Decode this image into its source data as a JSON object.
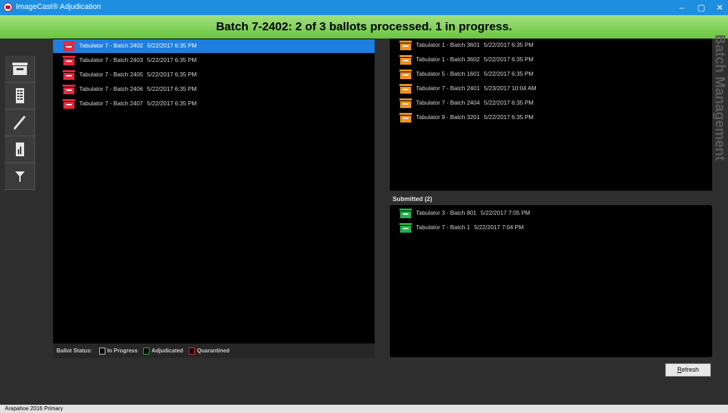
{
  "window": {
    "title": "ImageCast® Adjudication",
    "minimize": "–",
    "maximize": "▢",
    "close": "✕"
  },
  "banner": {
    "text": "Batch 7-2402: 2 of 3 ballots processed. 1 in progress."
  },
  "toolbar": {
    "items": [
      "batch-box",
      "ballot-list",
      "pencil",
      "report",
      "filter"
    ]
  },
  "left_list": {
    "items": [
      {
        "name": "Tabulator 7 - Batch 2402",
        "date": "5/22/2017 6:35 PM",
        "status": "quarantined",
        "selected": true
      },
      {
        "name": "Tabulator 7 - Batch 2403",
        "date": "5/22/2017 6:35 PM",
        "status": "quarantined",
        "selected": false
      },
      {
        "name": "Tabulator 7 - Batch 2405",
        "date": "5/22/2017 6:35 PM",
        "status": "quarantined",
        "selected": false
      },
      {
        "name": "Tabulator 7 - Batch 2406",
        "date": "5/22/2017 6:35 PM",
        "status": "quarantined",
        "selected": false
      },
      {
        "name": "Tabulator 7 - Batch 2407",
        "date": "5/22/2017 6:35 PM",
        "status": "quarantined",
        "selected": false
      }
    ]
  },
  "ballot_status": {
    "label": "Ballot Status:",
    "in_progress": "In Progress",
    "adjudicated": "Adjudicated",
    "quarantined": "Quarantined"
  },
  "right_top_list": {
    "items": [
      {
        "name": "Tabulator 1 - Batch 3601",
        "date": "5/22/2017 6:35 PM"
      },
      {
        "name": "Tabulator 1 - Batch 3602",
        "date": "5/22/2017 6:35 PM"
      },
      {
        "name": "Tabulator 5 - Batch 1601",
        "date": "5/22/2017 6:35 PM"
      },
      {
        "name": "Tabulator 7 - Batch 2401",
        "date": "5/23/2017 10:04 AM"
      },
      {
        "name": "Tabulator 7 - Batch 2404",
        "date": "5/22/2017 6:35 PM"
      },
      {
        "name": "Tabulator 9 - Batch 3201",
        "date": "5/22/2017 6:35 PM"
      }
    ]
  },
  "side_title": "Batch Management",
  "submitted": {
    "label": "Submitted (2)",
    "items": [
      {
        "name": "Tabulator 3 - Batch 801",
        "date": "5/22/2017 7:05 PM"
      },
      {
        "name": "Tabulator 7 - Batch 1",
        "date": "5/22/2017 7:04 PM"
      }
    ]
  },
  "refresh_button": {
    "prefix": "",
    "underlined": "R",
    "rest": "efresh"
  },
  "footer": {
    "election": "Arapahoe 2016 Primary"
  },
  "colors": {
    "quarantined": "#e8283c",
    "pending": "#f0901e",
    "submitted": "#1fb34a",
    "selected": "#1e7fe0",
    "banner": "#7ed352"
  }
}
